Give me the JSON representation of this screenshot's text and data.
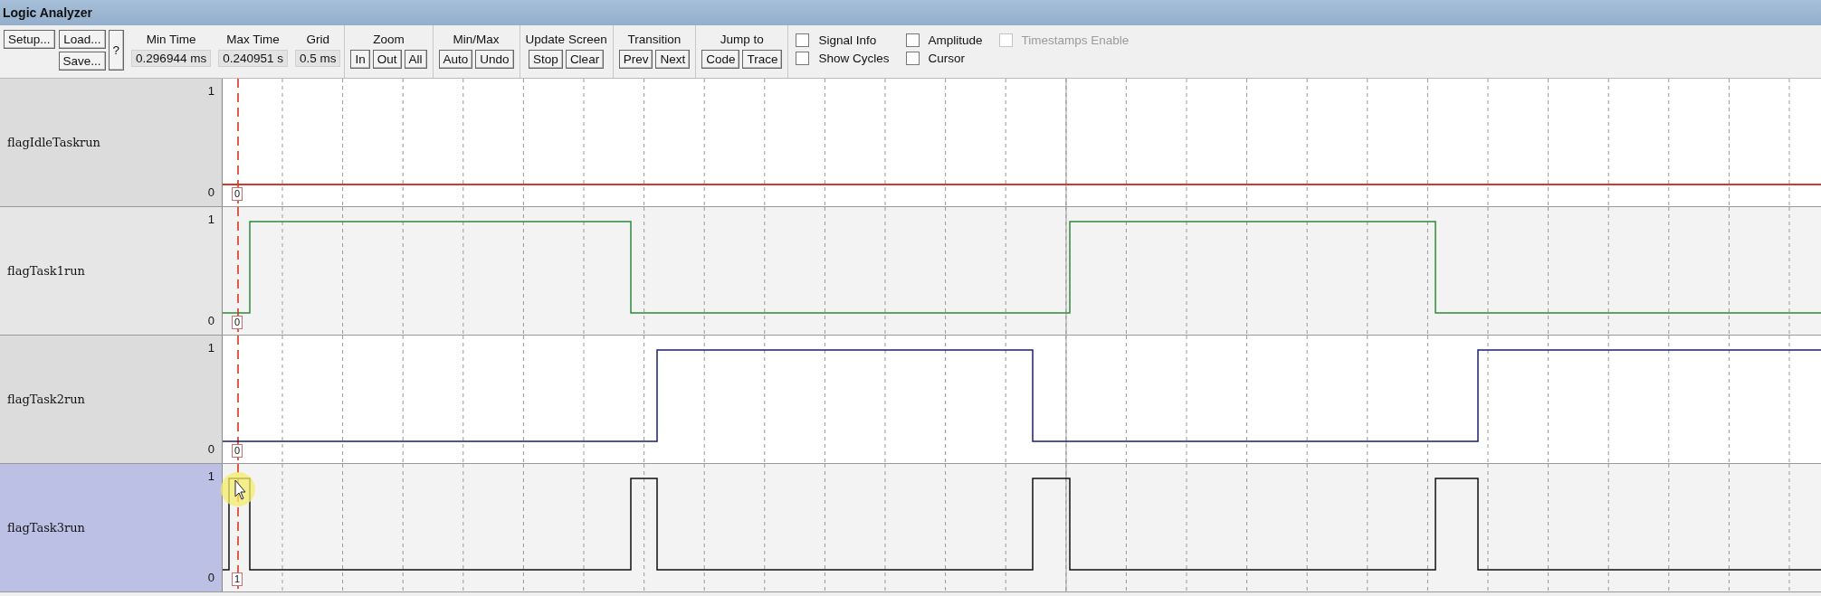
{
  "window": {
    "title": "Logic Analyzer"
  },
  "toolbar": {
    "file_buttons": [
      "Setup...",
      "Load...",
      "Save..."
    ],
    "help_button": "?",
    "fields": [
      {
        "label": "Min Time",
        "value": "0.296944 ms"
      },
      {
        "label": "Max Time",
        "value": "0.240951 s"
      },
      {
        "label": "Grid",
        "value": "0.5 ms"
      }
    ],
    "groups": [
      {
        "label": "Zoom",
        "buttons": [
          "In",
          "Out",
          "All"
        ]
      },
      {
        "label": "Min/Max",
        "buttons": [
          "Auto",
          "Undo"
        ]
      },
      {
        "label": "Update Screen",
        "buttons": [
          "Stop",
          "Clear"
        ]
      },
      {
        "label": "Transition",
        "buttons": [
          "Prev",
          "Next"
        ]
      },
      {
        "label": "Jump to",
        "buttons": [
          "Code",
          "Trace"
        ]
      }
    ],
    "checkboxes": [
      {
        "label": "Signal Info",
        "checked": false,
        "disabled": false
      },
      {
        "label": "Show Cycles",
        "checked": false,
        "disabled": false
      },
      {
        "label": "Amplitude",
        "checked": false,
        "disabled": false
      },
      {
        "label": "Cursor",
        "checked": false,
        "disabled": false
      },
      {
        "label": "Timestamps Enable",
        "checked": false,
        "disabled": true
      }
    ]
  },
  "signals": [
    {
      "name": "flagIdleTaskrun",
      "high_label": "1",
      "low_label": "0",
      "value": "0",
      "color": "#d03a2c",
      "selected": false
    },
    {
      "name": "flagTask1run",
      "high_label": "1",
      "low_label": "0",
      "value": "0",
      "color": "#2e8b3a",
      "selected": false
    },
    {
      "name": "flagTask2run",
      "high_label": "1",
      "low_label": "0",
      "value": "0",
      "color": "#1c1f6e",
      "selected": false
    },
    {
      "name": "flagTask3run",
      "high_label": "1",
      "low_label": "0",
      "value": "1",
      "color": "#111111",
      "selected": true
    }
  ]
}
